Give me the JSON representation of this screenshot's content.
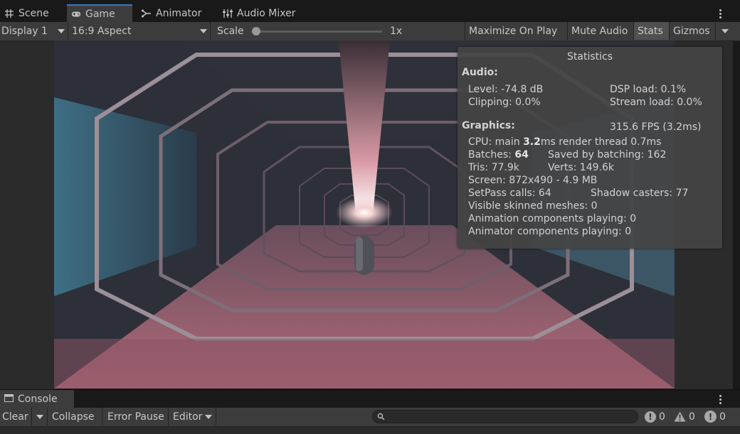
{
  "tabs": [
    {
      "label": "Scene",
      "icon": "grid-icon"
    },
    {
      "label": "Game",
      "icon": "gamepad-icon"
    },
    {
      "label": "Animator",
      "icon": "animator-icon"
    },
    {
      "label": "Audio Mixer",
      "icon": "mixer-icon"
    }
  ],
  "toolbar": {
    "display": "Display 1",
    "aspect": "16:9 Aspect",
    "scale_label": "Scale",
    "scale_value": "1x",
    "scale_fraction": 0.0,
    "maximize": "Maximize On Play",
    "mute": "Mute Audio",
    "stats": "Stats",
    "gizmos": "Gizmos"
  },
  "stats": {
    "title": "Statistics",
    "audio_header": "Audio:",
    "level": "Level: -74.8 dB",
    "dsp": "DSP load: 0.1%",
    "clipping": "Clipping: 0.0%",
    "stream": "Stream load: 0.0%",
    "graphics_header": "Graphics:",
    "fps": "315.6 FPS (3.2ms)",
    "cpu_pre": "CPU: main ",
    "cpu_main": "3.2",
    "cpu_post": "ms  render thread 0.7ms",
    "batches_pre": "Batches: ",
    "batches": "64",
    "saved": "Saved by batching: 162",
    "tris": "Tris: 77.9k",
    "verts": "Verts: 149.6k",
    "screen": "Screen: 872x490 - 4.9 MB",
    "setpass": "SetPass calls: 64",
    "shadow": "Shadow casters: 77",
    "skinned": "Visible skinned meshes: 0",
    "animation": "Animation components playing: 0",
    "animator": "Animator components playing: 0"
  },
  "console": {
    "tab": "Console",
    "clear": "Clear",
    "collapse": "Collapse",
    "error_pause": "Error Pause",
    "editor": "Editor",
    "log_count": "0",
    "warn_count": "0",
    "error_count": "0"
  },
  "colors": {
    "accent": "#3a79bb",
    "panel": "#3c3c3c",
    "dark": "#191919"
  }
}
